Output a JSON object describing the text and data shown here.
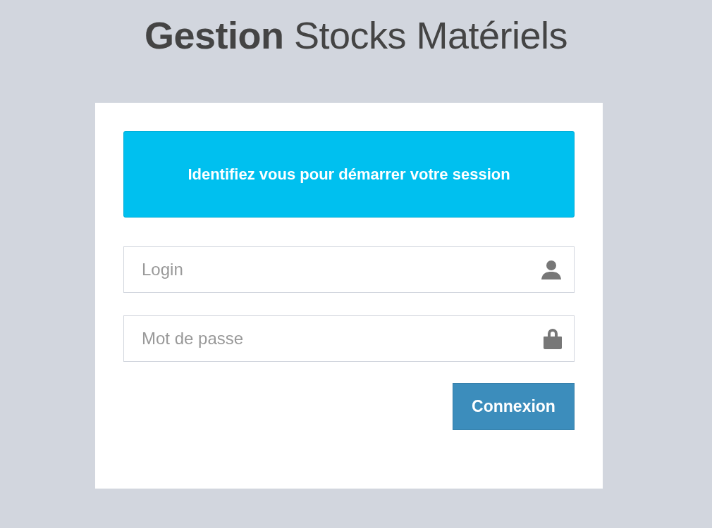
{
  "title": "**Gestion** Stocks Matériels",
  "message": "Identifiez vous pour démarrer votre session",
  "fields": [
    {
      "kind": "user",
      "placeholder": "Login"
    },
    {
      "kind": "password",
      "placeholder": "Mot de passe"
    }
  ],
  "submit": "Connexion"
}
